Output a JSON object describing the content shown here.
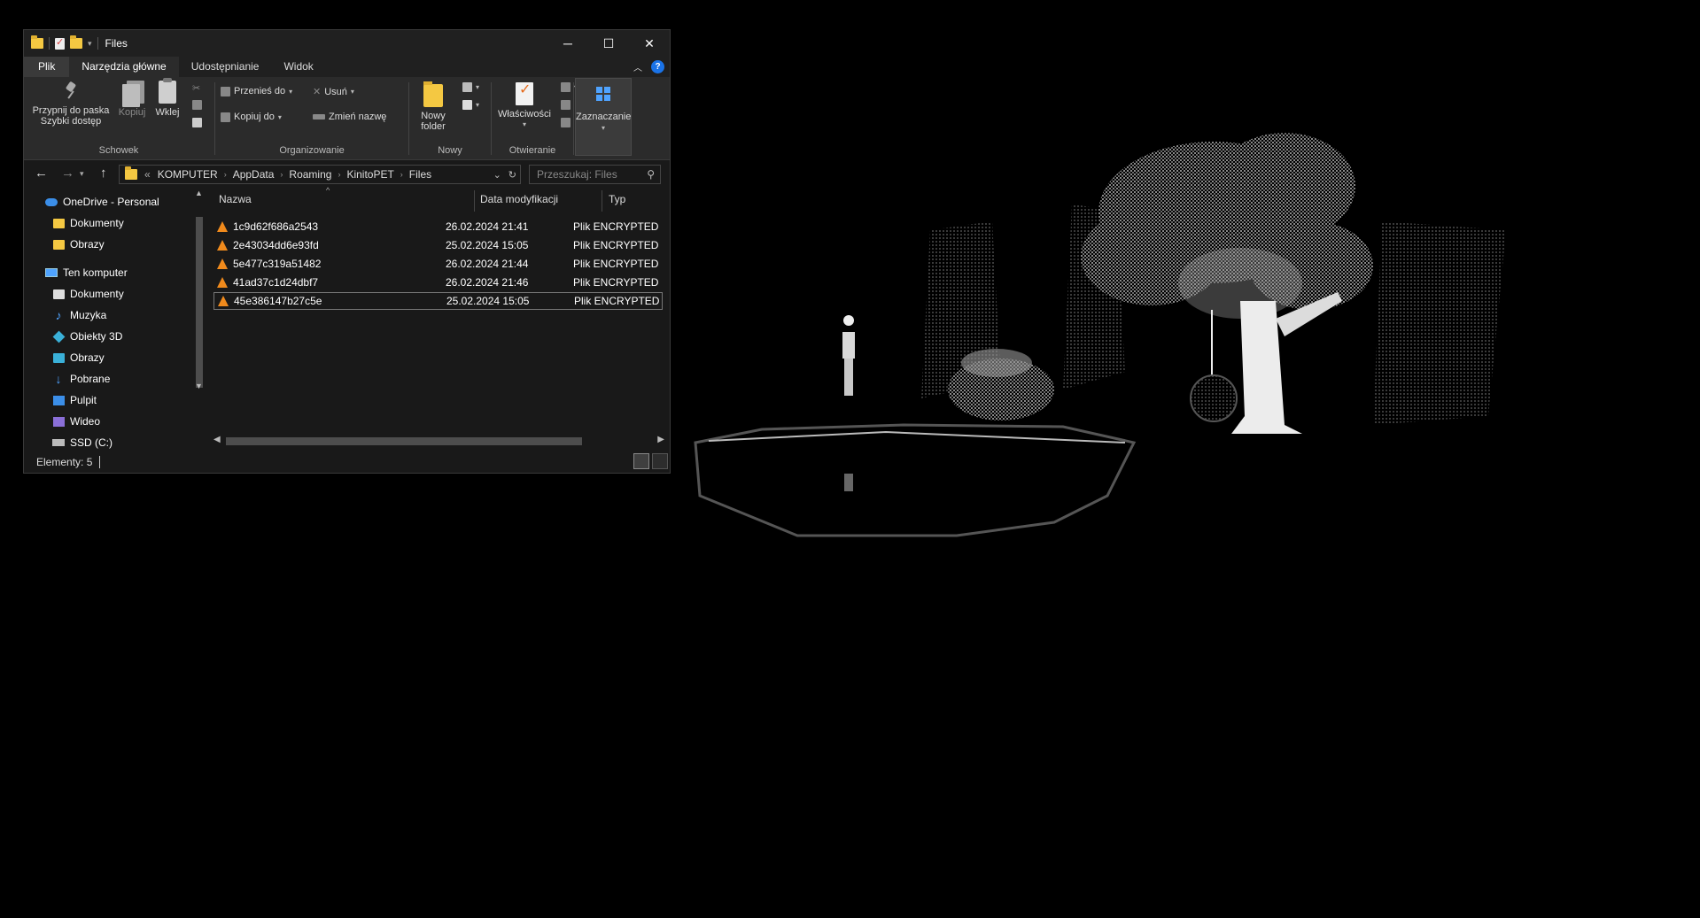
{
  "window": {
    "title": "Files",
    "minimize": "─",
    "maximize": "☐",
    "close": "✕"
  },
  "ribbon_tabs": [
    "Plik",
    "Narzędzia główne",
    "Udostępnianie",
    "Widok"
  ],
  "ribbon": {
    "clipboard": {
      "label": "Schowek",
      "pin": "Przypnij do paska",
      "pin2": "Szybki dostęp",
      "copy": "Kopiuj",
      "paste": "Wklej"
    },
    "organize": {
      "label": "Organizowanie",
      "move_to": "Przenieś do",
      "copy_to": "Kopiuj do",
      "delete": "Usuń",
      "rename": "Zmień nazwę"
    },
    "new": {
      "label": "Nowy",
      "new_folder": "Nowy",
      "new_folder2": "folder"
    },
    "open": {
      "label": "Otwieranie",
      "properties": "Właściwości"
    },
    "select": {
      "label": "Zaznaczanie"
    }
  },
  "address": {
    "prefix": "«",
    "crumbs": [
      "KOMPUTER",
      "AppData",
      "Roaming",
      "KinitoPET",
      "Files"
    ],
    "search_placeholder": "Przeszukaj: Files"
  },
  "nav_pane": {
    "items": [
      {
        "label": "OneDrive - Personal",
        "icon": "onedrive-icon"
      },
      {
        "label": "Dokumenty",
        "icon": "folder-icon"
      },
      {
        "label": "Obrazy",
        "icon": "folder-icon"
      },
      {
        "label": "Ten komputer",
        "icon": "computer-icon"
      },
      {
        "label": "Dokumenty",
        "icon": "documents-icon"
      },
      {
        "label": "Muzyka",
        "icon": "music-icon"
      },
      {
        "label": "Obiekty 3D",
        "icon": "objects-3d-icon"
      },
      {
        "label": "Obrazy",
        "icon": "pictures-icon"
      },
      {
        "label": "Pobrane",
        "icon": "download-icon"
      },
      {
        "label": "Pulpit",
        "icon": "desktop-icon"
      },
      {
        "label": "Wideo",
        "icon": "video-icon"
      },
      {
        "label": "SSD (C:)",
        "icon": "drive-icon"
      }
    ]
  },
  "columns": {
    "name": "Nazwa",
    "date": "Data modyfikacji",
    "type": "Typ"
  },
  "files": [
    {
      "name": "1c9d62f686a2543",
      "date": "26.02.2024 21:41",
      "type": "Plik ENCRYPTED"
    },
    {
      "name": "2e43034dd6e93fd",
      "date": "25.02.2024 15:05",
      "type": "Plik ENCRYPTED"
    },
    {
      "name": "5e477c319a51482",
      "date": "26.02.2024 21:44",
      "type": "Plik ENCRYPTED"
    },
    {
      "name": "41ad37c1d24dbf7",
      "date": "26.02.2024 21:46",
      "type": "Plik ENCRYPTED"
    },
    {
      "name": "45e386147b27c5e",
      "date": "25.02.2024 15:05",
      "type": "Plik ENCRYPTED"
    }
  ],
  "status": {
    "count": "Elementy: 5"
  },
  "colors": {
    "window_bg": "#191919",
    "ribbon_bg": "#2b2b2b",
    "folder": "#f4c842",
    "vlc_orange": "#f08a1c",
    "accent_blue": "#4fa3ff"
  }
}
